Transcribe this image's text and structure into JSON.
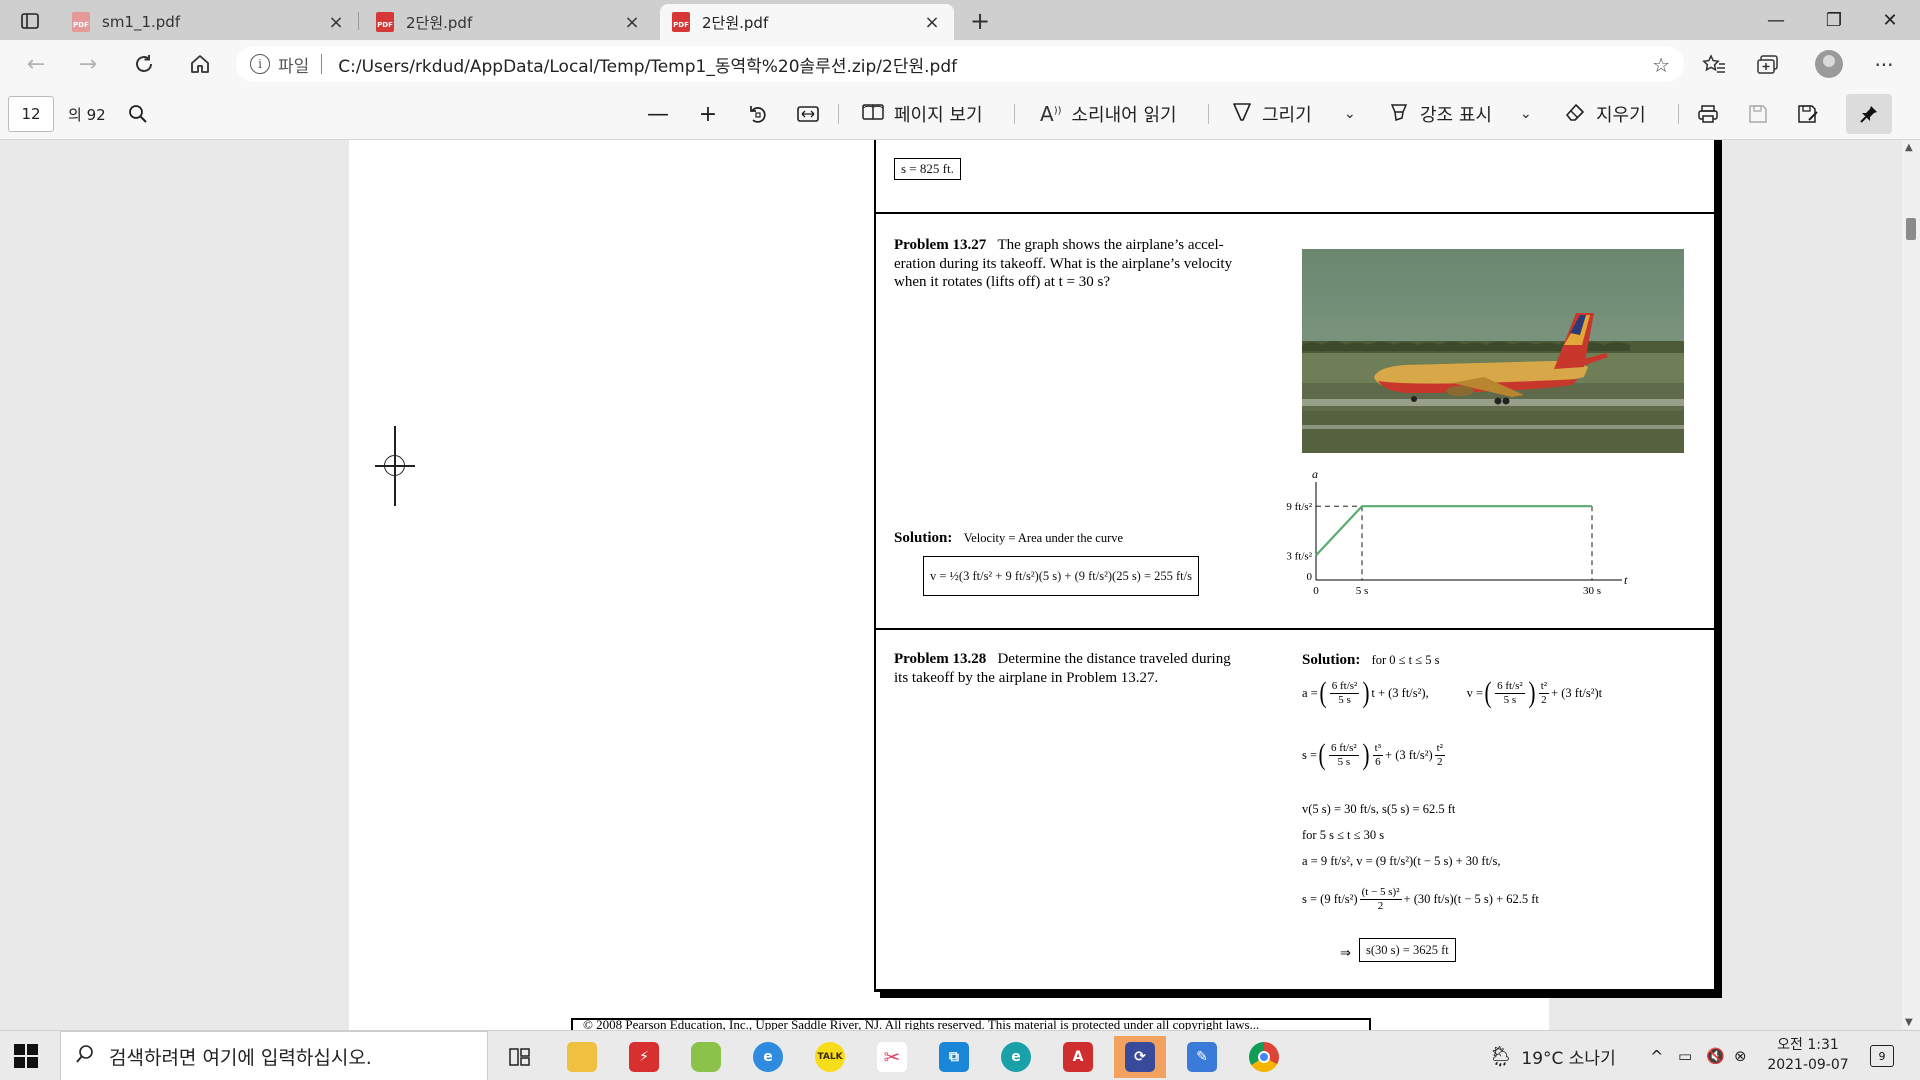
{
  "tabs": [
    {
      "title": "sm1_1.pdf",
      "active": false
    },
    {
      "title": "2단원.pdf",
      "active": false
    },
    {
      "title": "2단원.pdf",
      "active": true
    }
  ],
  "window_controls": {
    "minimize": "—",
    "restore": "❐",
    "close": "✕"
  },
  "address": {
    "scheme_label": "파일",
    "url": "C:/Users/rkdud/AppData/Local/Temp/Temp1_동역학%20솔루션.zip/2단원.pdf"
  },
  "pdf_toolbar": {
    "page_number": "12",
    "page_total": "의 92",
    "page_view_label": "페이지 보기",
    "read_aloud_label": "소리내어 읽기",
    "draw_label": "그리기",
    "highlight_label": "강조 표시",
    "erase_label": "지우기"
  },
  "document": {
    "prev_answer": "s = 825 ft.",
    "p27": {
      "heading": "Problem 13.27",
      "text_line1": "The graph shows the airplane’s accel-",
      "text_line2": "eration during its takeoff. What is the airplane’s velocity",
      "text_line3": "when it rotates (lifts off) at t = 30 s?",
      "solution_label": "Solution:",
      "solution_note": "Velocity = Area under the curve",
      "answer": "v = ½(3 ft/s² + 9 ft/s²)(5 s) + (9 ft/s²)(25 s) = 255 ft/s"
    },
    "p28": {
      "heading": "Problem 13.28",
      "text_line1": "Determine the distance traveled during",
      "text_line2": "its takeoff by the airplane in Problem 13.27.",
      "solution_label": "Solution:",
      "range1": "for 0 ≤ t ≤ 5 s",
      "a_prefix": "a =",
      "frac_num": "6 ft/s²",
      "frac_den": "5 s",
      "a_suffix": "t + (3 ft/s²),",
      "v_prefix": "v =",
      "t2_num": "t²",
      "two_den": "2",
      "v_suffix": "+ (3 ft/s²)t",
      "s_prefix": "s =",
      "t3_num": "t³",
      "six_den": "6",
      "s_mid": "+ (3 ft/s²)",
      "values_at_5": "v(5 s) = 30 ft/s,   s(5 s) = 62.5 ft",
      "range2": "for 5 s ≤ t ≤ 30 s",
      "a2_v2": "a = 9 ft/s²,     v = (9 ft/s²)(t − 5 s) + 30 ft/s,",
      "s2_prefix": "s = (9 ft/s²)",
      "s2_num": "(t − 5 s)²",
      "s2_den": "2",
      "s2_suffix": "+ (30 ft/s)(t − 5 s) + 62.5 ft",
      "implies": "⇒",
      "final_answer": "s(30 s) = 3625 ft"
    },
    "graph_labels": {
      "a_axis": "a",
      "t_axis": "t",
      "y_9": "9 ft/s²",
      "y_3": "3 ft/s²",
      "y_0": "0",
      "x_0": "0",
      "x_5": "5 s",
      "x_30": "30 s"
    },
    "footer_partial": "© 2008 Pearson Education, Inc., Upper Saddle River, NJ. All rights reserved. This material is protected under all copyright laws..."
  },
  "taskbar": {
    "search_placeholder": "검색하려면 여기에 입력하십시오.",
    "weather": "19°C  소나기",
    "time": "오전 1:31",
    "date": "2021-09-07",
    "notification_count": "9"
  },
  "colors": {
    "graph_line": "#5aab6e",
    "pdf_icon": "#d63838",
    "active_app": "#f2a25e"
  }
}
